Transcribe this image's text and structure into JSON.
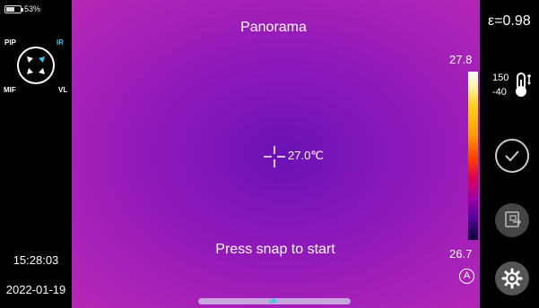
{
  "status": {
    "battery_text": "53%",
    "battery_level": 0.53
  },
  "modes": {
    "pip": "PIP",
    "ir": "IR",
    "mif": "MIF",
    "vl": "VL"
  },
  "clock": {
    "time": "15:28:03",
    "date": "2022-01-19"
  },
  "viewport": {
    "title": "Panorama",
    "spot_temp": "27.0℃",
    "prompt": "Press snap to start"
  },
  "scale": {
    "max": "27.8",
    "min": "26.7",
    "auto_label": "A"
  },
  "right": {
    "emissivity": "ε=0.98",
    "range_high": "150",
    "range_low": "-40"
  },
  "icons": {
    "confirm": "check-circle-icon",
    "gallery": "gallery-icon",
    "settings": "gear-icon",
    "thermometer": "thermometer-icon"
  },
  "colors": {
    "accent": "#35c7e6",
    "palette_top": "#ffffff",
    "palette_bottom": "#0b0035"
  }
}
